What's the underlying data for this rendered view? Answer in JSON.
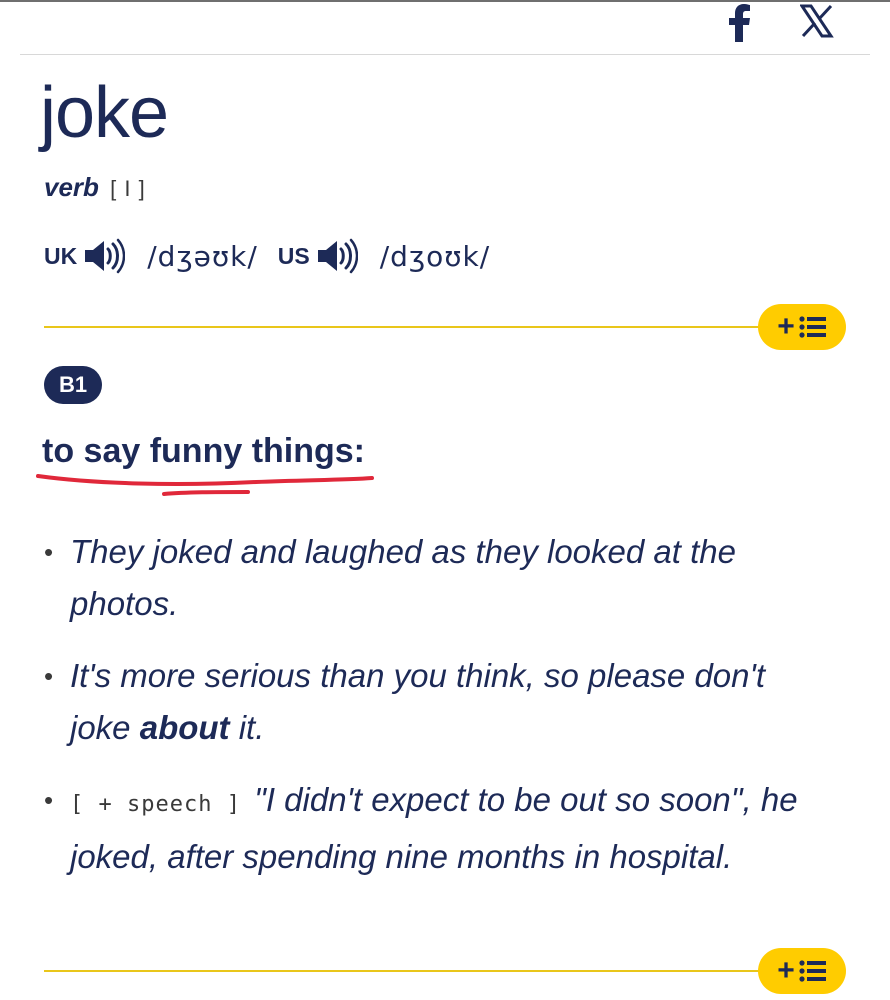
{
  "share": {
    "facebook_icon": "facebook-icon",
    "x_icon": "x-twitter-icon"
  },
  "entry": {
    "headword": "joke",
    "part_of_speech": "verb",
    "grammar": "[ I ]",
    "pronunciations": [
      {
        "region": "UK",
        "ipa": "/dʒəʊk/",
        "icon": "speaker-icon"
      },
      {
        "region": "US",
        "ipa": "/dʒoʊk/",
        "icon": "speaker-icon"
      }
    ]
  },
  "sense": {
    "level": "B1",
    "definition": "to say funny things:",
    "examples": [
      {
        "text": "They joked and laughed as they looked at the photos."
      },
      {
        "before": "It's more serious than you think, so please don't joke ",
        "bold": "about",
        "after": " it."
      },
      {
        "grammar": "[ + speech ]",
        "text": "\"I didn't expect to be out so soon\", he joked, after spending nine months in hospital."
      }
    ]
  },
  "controls": {
    "add_to_list_plus": "+",
    "add_to_list_icon": "list-icon"
  },
  "colors": {
    "navy": "#1d2a57",
    "accent_yellow": "#ffcc00",
    "divider_yellow": "#e9c61a",
    "annotation_red": "#e0283a"
  }
}
